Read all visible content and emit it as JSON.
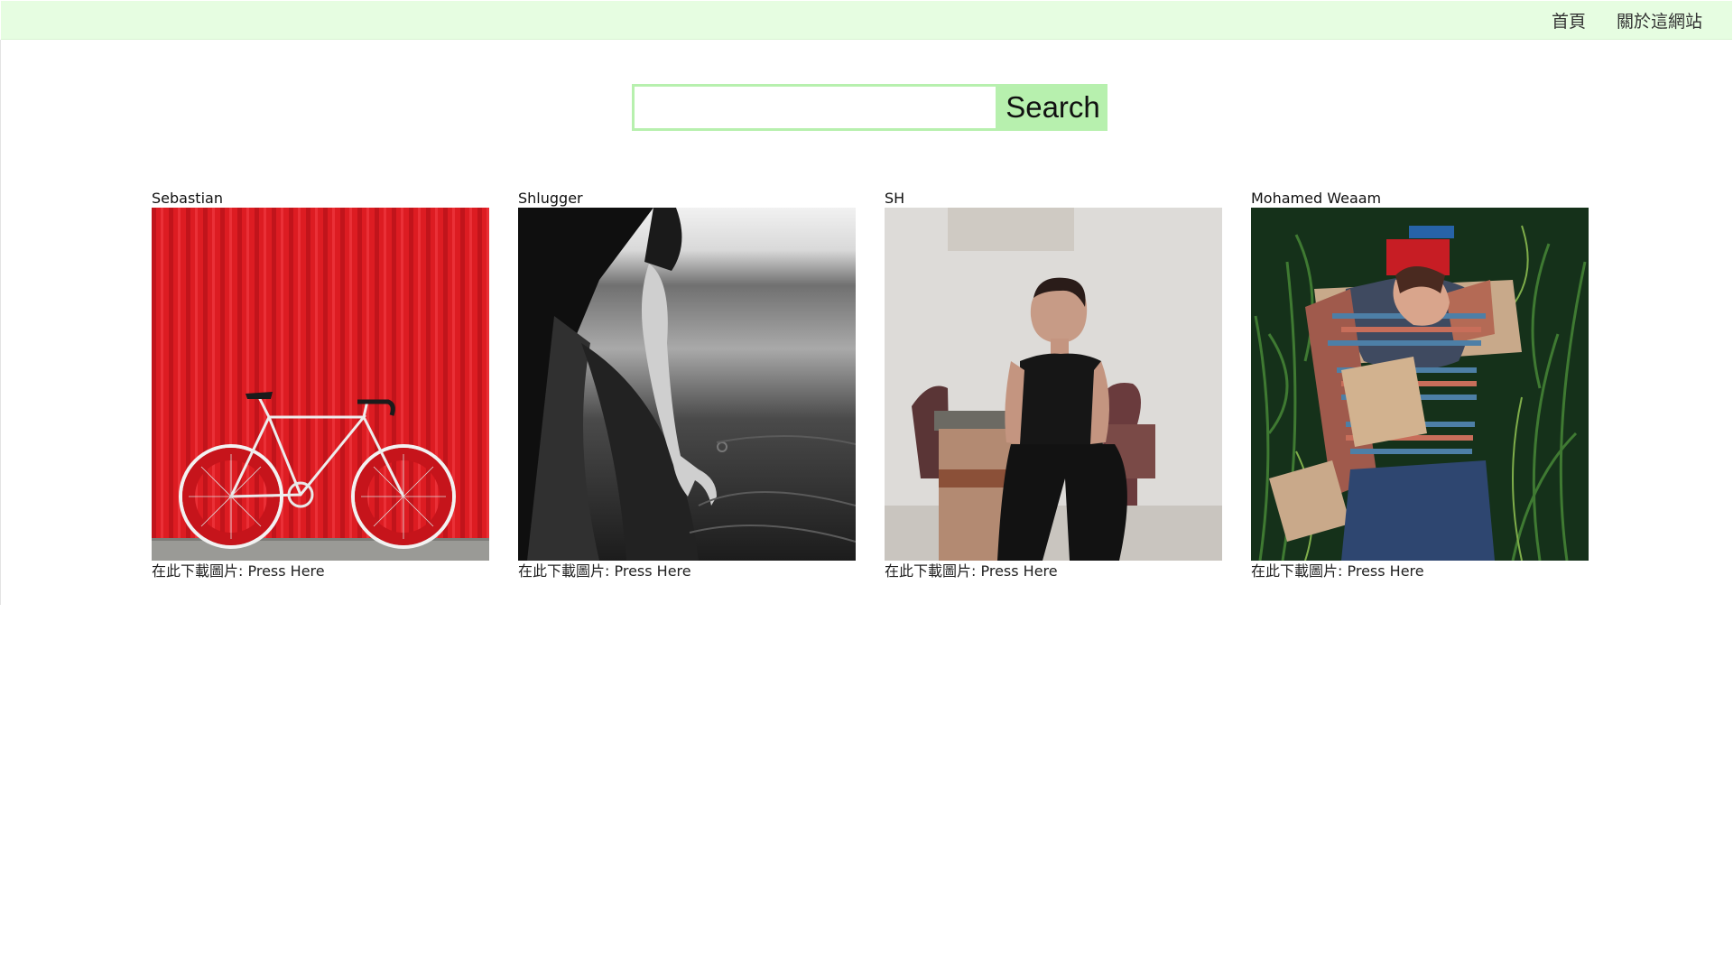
{
  "nav": {
    "home_label": "首頁",
    "about_label": "關於這網站"
  },
  "search": {
    "value": "",
    "placeholder": "",
    "button_label": "Search"
  },
  "gallery": {
    "caption_prefix": "在此下載圖片: ",
    "link_text": "Press Here",
    "cards": [
      {
        "author": "Sebastian",
        "photo": "red-wall-white-bicycle"
      },
      {
        "author": "Shlugger",
        "photo": "black-and-white-hand-touching-water"
      },
      {
        "author": "SH",
        "photo": "woman-in-black-sitting-by-table"
      },
      {
        "author": "Mohamed Weaam",
        "photo": "man-lying-in-grass-with-cardboard"
      }
    ]
  },
  "colors": {
    "navbar_bg": "#e6fde1",
    "search_accent": "#b7f0ae"
  }
}
